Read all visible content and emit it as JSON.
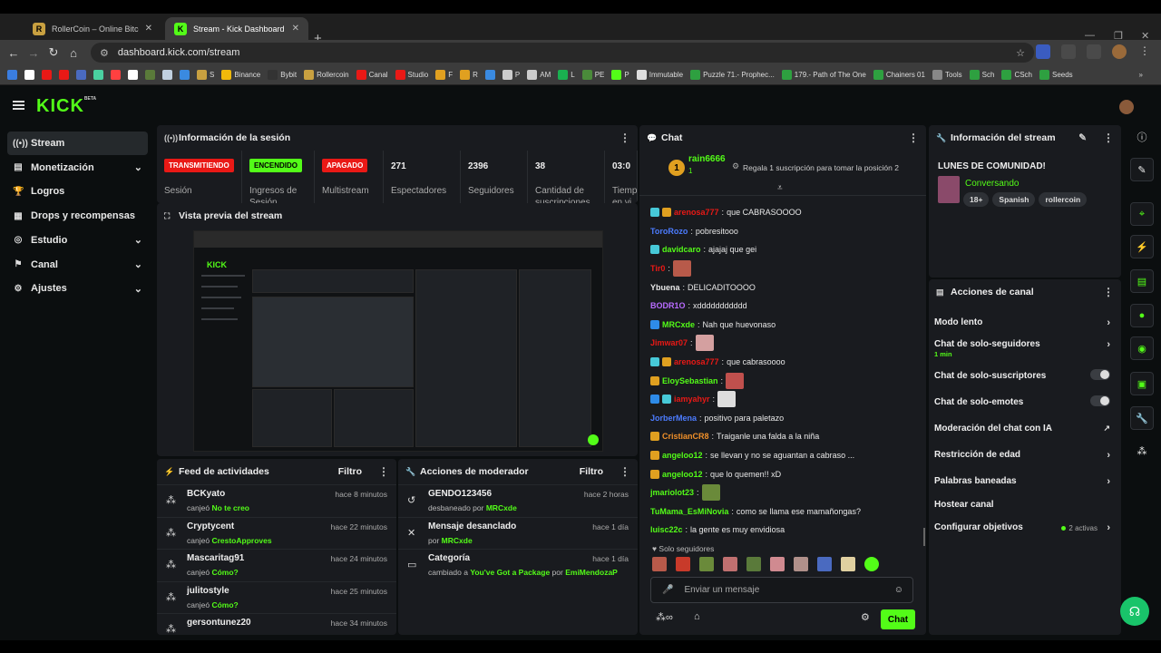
{
  "browser": {
    "tabs": [
      {
        "title": "RollerCoin – Online Bitcoin Min",
        "active": false
      },
      {
        "title": "Stream - Kick Dashboard",
        "active": true
      }
    ],
    "url": "dashboard.kick.com/stream",
    "bookmarks": [
      "",
      "",
      "",
      "",
      "",
      "",
      "",
      "",
      "",
      "",
      "",
      "S",
      "Binance",
      "Bybit",
      "Rollercoin",
      "Canal",
      "Studio",
      "F",
      "R",
      "",
      "P",
      "AM",
      "L",
      "PE",
      "P",
      "Immutable",
      "Puzzle 71.- Prophec...",
      "179.- Path of The One",
      "Chainers 01",
      "Tools",
      "Sch",
      "CSch",
      "Seeds"
    ]
  },
  "kick": {
    "logo": "KICK",
    "logo_tag": "BETA"
  },
  "sidebar": {
    "items": [
      {
        "label": "Stream",
        "icon": "broadcast-icon",
        "active": true,
        "expandable": false
      },
      {
        "label": "Monetización",
        "icon": "money-icon",
        "active": false,
        "expandable": true
      },
      {
        "label": "Logros",
        "icon": "trophy-icon",
        "active": false,
        "expandable": false
      },
      {
        "label": "Drops y recompensas",
        "icon": "gift-icon",
        "active": false,
        "expandable": false
      },
      {
        "label": "Estudio",
        "icon": "studio-icon",
        "active": false,
        "expandable": true
      },
      {
        "label": "Canal",
        "icon": "channel-icon",
        "active": false,
        "expandable": true
      },
      {
        "label": "Ajustes",
        "icon": "gear-icon",
        "active": false,
        "expandable": true
      }
    ]
  },
  "session": {
    "title": "Información de la sesión",
    "cells": [
      {
        "badge": "TRANSMITIENDO",
        "badge_bg": "#e91916",
        "badge_fg": "#ffffff",
        "label": "Sesión"
      },
      {
        "badge": "ENCENDIDO",
        "badge_bg": "#53fc18",
        "badge_fg": "#000000",
        "label": "Ingresos de Sesión"
      },
      {
        "badge": "APAGADO",
        "badge_bg": "#e91916",
        "badge_fg": "#ffffff",
        "label": "Multistream"
      },
      {
        "value": "271",
        "label": "Espectadores"
      },
      {
        "value": "2396",
        "label": "Seguidores"
      },
      {
        "value": "38",
        "label": "Cantidad de suscripciones"
      },
      {
        "value": "03:0",
        "label": "Tiempo en vi"
      }
    ]
  },
  "preview": {
    "title": "Vista previa del stream"
  },
  "activity": {
    "title": "Feed de actividades",
    "filter": "Filtro",
    "rows": [
      {
        "user": "BCKyato",
        "action": "canjeó",
        "reward": "No te creo",
        "time": "hace 8 minutos"
      },
      {
        "user": "Cryptycent",
        "action": "canjeó",
        "reward": "CrestoApproves",
        "time": "hace 22 minutos"
      },
      {
        "user": "Mascaritag91",
        "action": "canjeó",
        "reward": "Cómo?",
        "time": "hace 24 minutos"
      },
      {
        "user": "julitostyle",
        "action": "canjeó",
        "reward": "Cómo?",
        "time": "hace 25 minutos"
      },
      {
        "user": "gersontunez20",
        "action": "",
        "reward": "",
        "time": "hace 34 minutos"
      }
    ]
  },
  "modactions": {
    "title": "Acciones de moderador",
    "filter": "Filtro",
    "rows": [
      {
        "icon": "unban-icon",
        "title": "GENDO123456",
        "desc": "desbaneado por",
        "by": "MRCxde",
        "time": "hace 2 horas"
      },
      {
        "icon": "unpin-icon",
        "title": "Mensaje desanclado",
        "desc": "por",
        "by": "MRCxde",
        "time": "hace 1 día"
      },
      {
        "icon": "category-icon",
        "title": "Categoría",
        "desc": "cambiado a",
        "highlight": "You've Got a Package",
        "desc2": "por",
        "by": "EmiMendozaP",
        "time": "hace 1 día"
      }
    ]
  },
  "chat": {
    "title": "Chat",
    "pinned_user": "rain6666",
    "pinned_rank": "1",
    "pinned_count": "1",
    "gift_text": "Regala 1 suscripción para tomar la posición 2",
    "messages": [
      {
        "user": "arenosa777",
        "color": "#e91916",
        "text": "que CABRASOOOO",
        "badges": [
          "#47c9d8",
          "#e0a020"
        ]
      },
      {
        "user": "ToroRozo",
        "color": "#4c7cff",
        "text": "pobresitooo",
        "badges": []
      },
      {
        "user": "davidcaro",
        "color": "#53fc18",
        "text": "ajajaj que gei",
        "badges": [
          "#47c9d8"
        ]
      },
      {
        "user": "Tir0",
        "color": "#e91916",
        "text": "",
        "emote": "#b85a4a",
        "badges": []
      },
      {
        "user": "Ybuena",
        "color": "#e8e8e8",
        "text": "DELICADITOOOO",
        "badges": []
      },
      {
        "user": "BODR1O",
        "color": "#b86bff",
        "text": "xddddddddddd",
        "badges": []
      },
      {
        "user": "MRCxde",
        "color": "#53fc18",
        "text": "Nah que huevonaso",
        "badges": [
          "#2e8be8"
        ]
      },
      {
        "user": "Jimwar07",
        "color": "#e91916",
        "text": "",
        "emote": "#d4a0a0",
        "badges": []
      },
      {
        "user": "arenosa777",
        "color": "#e91916",
        "text": "que cabrasoooo",
        "badges": [
          "#47c9d8",
          "#e0a020"
        ]
      },
      {
        "user": "EloySebastian",
        "color": "#53fc18",
        "text": "",
        "emote": "#c0504d",
        "badges": [
          "#e0a020"
        ]
      },
      {
        "user": "iamyahyr",
        "color": "#e91916",
        "text": "",
        "emote": "#dddddd",
        "badges": [
          "#2e8be8",
          "#47c9d8"
        ]
      },
      {
        "user": "JorberMena",
        "color": "#4c7cff",
        "text": "positivo para paletazo",
        "badges": []
      },
      {
        "user": "CristianCR8",
        "color": "#f0902a",
        "text": "Traiganle una falda a la niña",
        "badges": [
          "#e0a020"
        ]
      },
      {
        "user": "angeloo12",
        "color": "#53fc18",
        "text": "se llevan y no se aguantan a cabraso ...",
        "badges": [
          "#e0a020"
        ]
      },
      {
        "user": "angeloo12",
        "color": "#53fc18",
        "text": "que lo quemen!! xD",
        "badges": [
          "#e0a020"
        ]
      },
      {
        "user": "jmariolot23",
        "color": "#53fc18",
        "text": "",
        "emote": "#6a8a3a",
        "badges": []
      },
      {
        "user": "TuMama_EsMiNovia",
        "color": "#53fc18",
        "text": "como se llama ese mamañongas?",
        "badges": []
      },
      {
        "user": "luisc22c",
        "color": "#53fc18",
        "text": "la gente es muy envidiosa",
        "badges": []
      }
    ],
    "followers_only": "Solo seguidores",
    "input_placeholder": "Enviar un mensaje",
    "send_label": "Chat"
  },
  "stream_info": {
    "title": "Información del stream",
    "stream_title": "LUNES DE COMUNIDAD!",
    "category": "Conversando",
    "tags": [
      "18+",
      "Spanish",
      "rollercoin"
    ]
  },
  "channel_actions": {
    "title": "Acciones de canal",
    "rows": [
      {
        "label": "Modo lento",
        "type": "arrow"
      },
      {
        "label": "Chat de solo-seguidores",
        "sub": "1 min",
        "type": "arrow"
      },
      {
        "label": "Chat de solo-suscriptores",
        "type": "toggle"
      },
      {
        "label": "Chat de solo-emotes",
        "type": "toggle"
      },
      {
        "label": "Moderación del chat con IA",
        "type": "external"
      },
      {
        "label": "Restricción de edad",
        "type": "arrow"
      },
      {
        "label": "Palabras baneadas",
        "type": "arrow"
      },
      {
        "label": "Hostear canal",
        "type": "none"
      },
      {
        "label": "Configurar objetivos",
        "extra": "2 activas",
        "type": "arrow"
      }
    ]
  }
}
